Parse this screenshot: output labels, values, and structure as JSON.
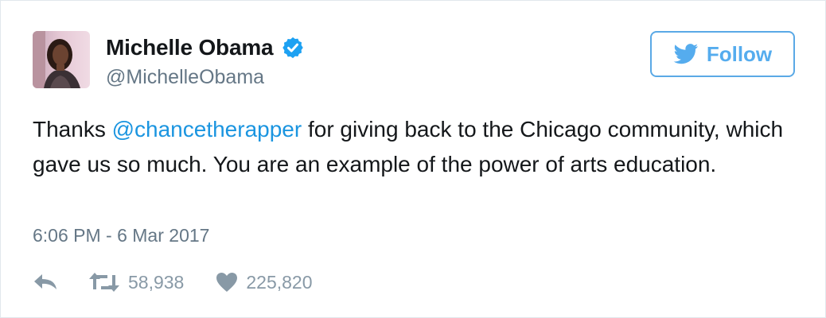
{
  "user": {
    "name": "Michelle Obama",
    "handle": "@MichelleObama",
    "verified": true
  },
  "follow_button": {
    "label": "Follow"
  },
  "tweet": {
    "text_before": "Thanks ",
    "mention": "@chancetherapper",
    "text_after": " for giving back to the Chicago community, which gave us so much. You are an example of the power of arts education.",
    "timestamp": "6:06 PM - 6 Mar 2017"
  },
  "actions": {
    "retweets": "58,938",
    "likes": "225,820"
  },
  "colors": {
    "accent": "#1b95e0",
    "follow": "#55acee",
    "muted": "#657786",
    "action_gray": "#8899a6",
    "text": "#14171a"
  },
  "icons": {
    "verified": "verified-badge-icon",
    "bird": "twitter-bird-icon",
    "reply": "reply-icon",
    "retweet": "retweet-icon",
    "like": "heart-icon"
  }
}
